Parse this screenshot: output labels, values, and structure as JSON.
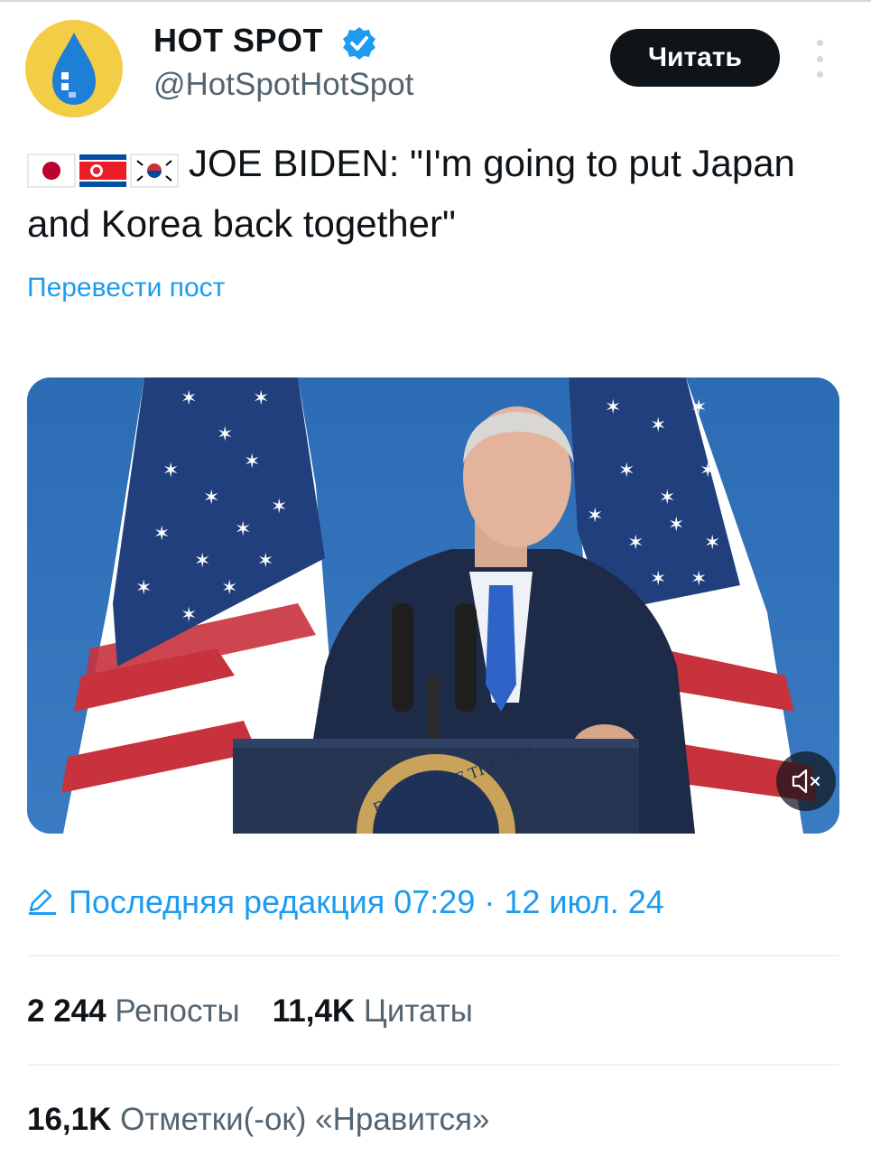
{
  "account": {
    "display_name": "HOT SPOT",
    "handle": "@HotSpotHotSpot",
    "verified_icon": "verified-badge-icon",
    "avatar_color": "#f2cd45"
  },
  "actions": {
    "read_label": "Читать",
    "more_icon": "more-vertical-icon"
  },
  "tweet": {
    "flags": [
      "japan-flag-icon",
      "north-korea-flag-icon",
      "south-korea-flag-icon"
    ],
    "text": "JOE BIDEN: \"I'm going to put Japan and Korea back together\"",
    "translate_label": "Перевести пост"
  },
  "media": {
    "type": "video",
    "mute_icon": "volume-muted-icon"
  },
  "meta": {
    "edited_icon": "pencil-icon",
    "edited_text": "Последняя редакция 07:29 · 12 июл. 24"
  },
  "stats": {
    "reposts_count": "2 244",
    "reposts_label": "Репосты",
    "quotes_count": "11,4K",
    "quotes_label": "Цитаты",
    "likes_count": "16,1K",
    "likes_label": "Отметки(-ок) «Нравится»"
  },
  "colors": {
    "accent": "#1d9bf0",
    "text": "#0f1419",
    "secondary": "#536471"
  }
}
